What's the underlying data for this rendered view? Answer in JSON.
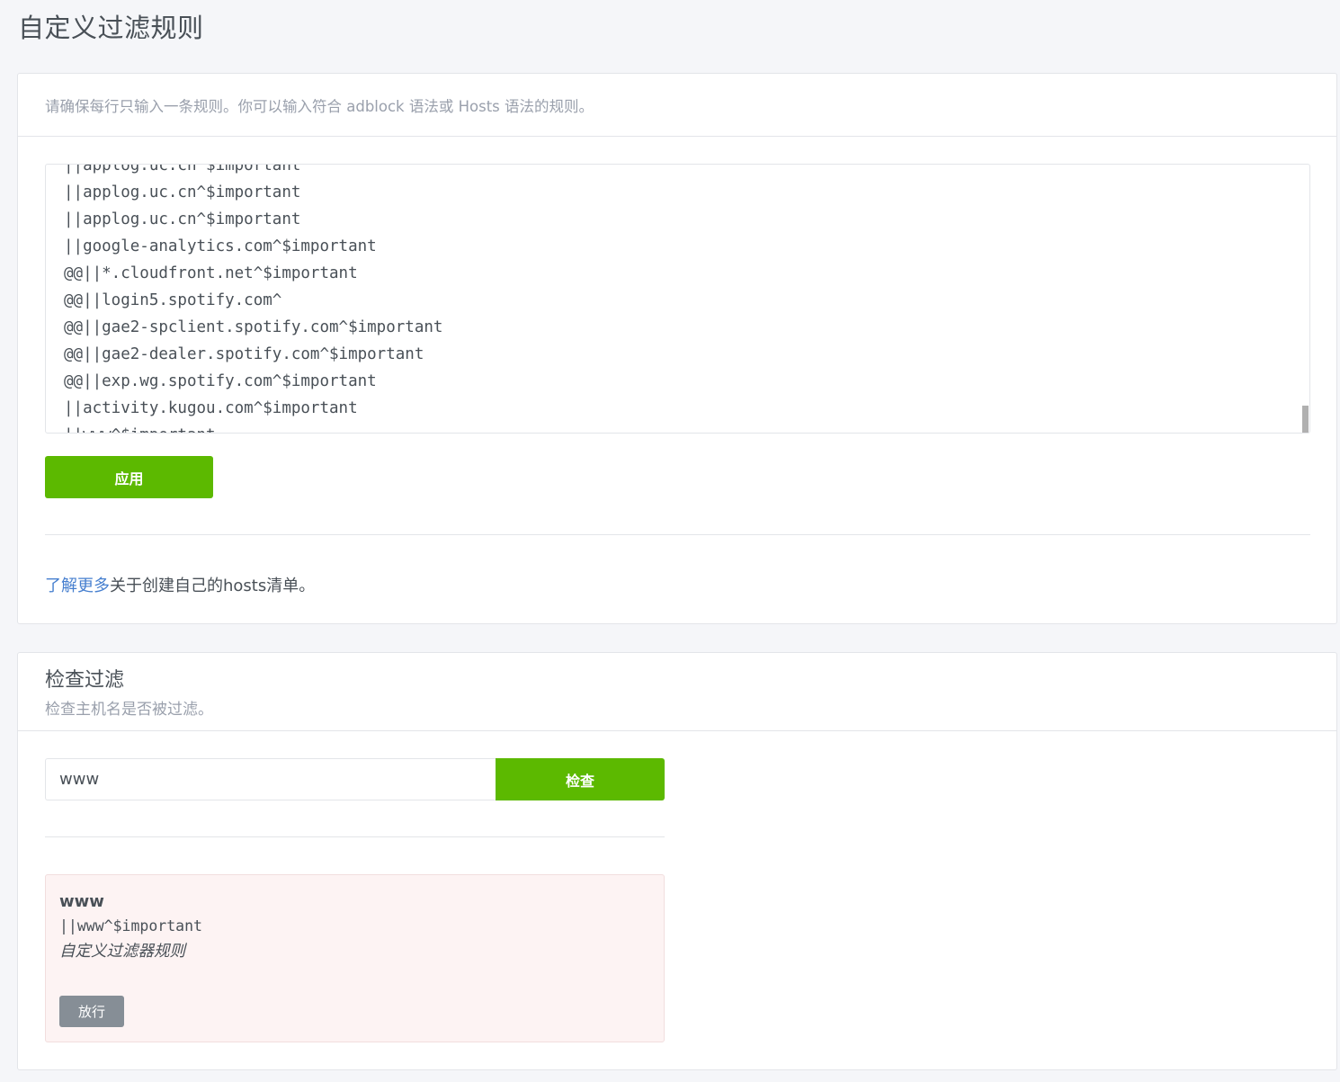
{
  "page": {
    "title": "自定义过滤规则"
  },
  "rules_card": {
    "description": "请确保每行只输入一条规则。你可以输入符合 adblock 语法或 Hosts 语法的规则。",
    "rules": [
      "||applog.uc.cn^$important",
      "||applog.uc.cn^$important",
      "||applog.uc.cn^$important",
      "||google-analytics.com^$important",
      "@@||*.cloudfront.net^$important",
      "@@||login5.spotify.com^",
      "@@||gae2-spclient.spotify.com^$important",
      "@@||gae2-dealer.spotify.com^$important",
      "@@||exp.wg.spotify.com^$important",
      "||activity.kugou.com^$important",
      "||www^$important"
    ],
    "apply_label": "应用",
    "learn_more_link": "了解更多",
    "learn_more_suffix": "关于创建自己的hosts清单。"
  },
  "check_card": {
    "title": "检查过滤",
    "subtitle": "检查主机名是否被过滤。",
    "input_value": "www",
    "check_label": "检查",
    "result": {
      "hostname": "www",
      "rule": "||www^$important",
      "source": "自定义过滤器规则",
      "unblock_label": "放行"
    }
  },
  "colors": {
    "accent_green": "#5cb900",
    "link_blue": "#467fcf",
    "result_bg": "#fdf3f3",
    "muted_button": "#868e96"
  }
}
